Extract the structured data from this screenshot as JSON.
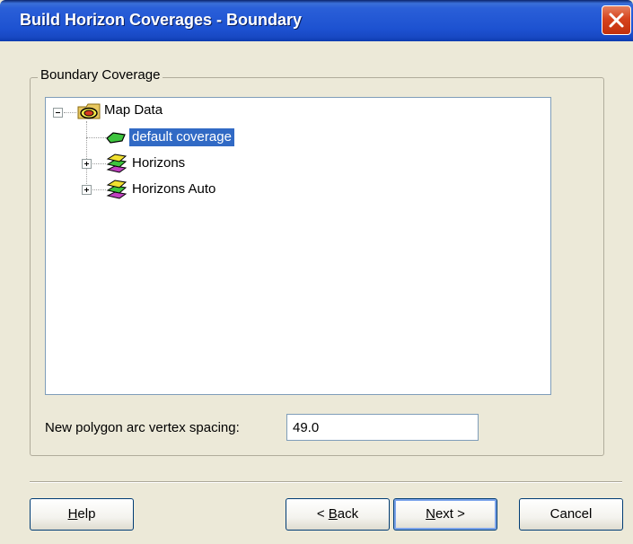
{
  "window": {
    "title": "Build Horizon Coverages - Boundary"
  },
  "group": {
    "legend": "Boundary Coverage"
  },
  "tree": {
    "root": {
      "label": "Map Data",
      "expanded": true,
      "icon": "map-data-icon"
    },
    "children": [
      {
        "label": "default coverage",
        "selected": true,
        "icon": "coverage-icon"
      },
      {
        "label": "Horizons",
        "expanded": false,
        "icon": "coverage-stack-icon"
      },
      {
        "label": "Horizons Auto",
        "expanded": false,
        "icon": "coverage-stack-icon"
      }
    ]
  },
  "spacing": {
    "label": "New polygon arc vertex spacing:",
    "value": "49.0"
  },
  "buttons": {
    "help": {
      "label": "Help",
      "mnemonic": "H"
    },
    "back": {
      "label": "< Back",
      "mnemonic": "B"
    },
    "next": {
      "label": "Next >",
      "mnemonic": "N"
    },
    "cancel": {
      "label": "Cancel"
    }
  },
  "colors": {
    "title_bar": "#1d52d1",
    "selection": "#316ac5",
    "close_button": "#d6431e"
  }
}
